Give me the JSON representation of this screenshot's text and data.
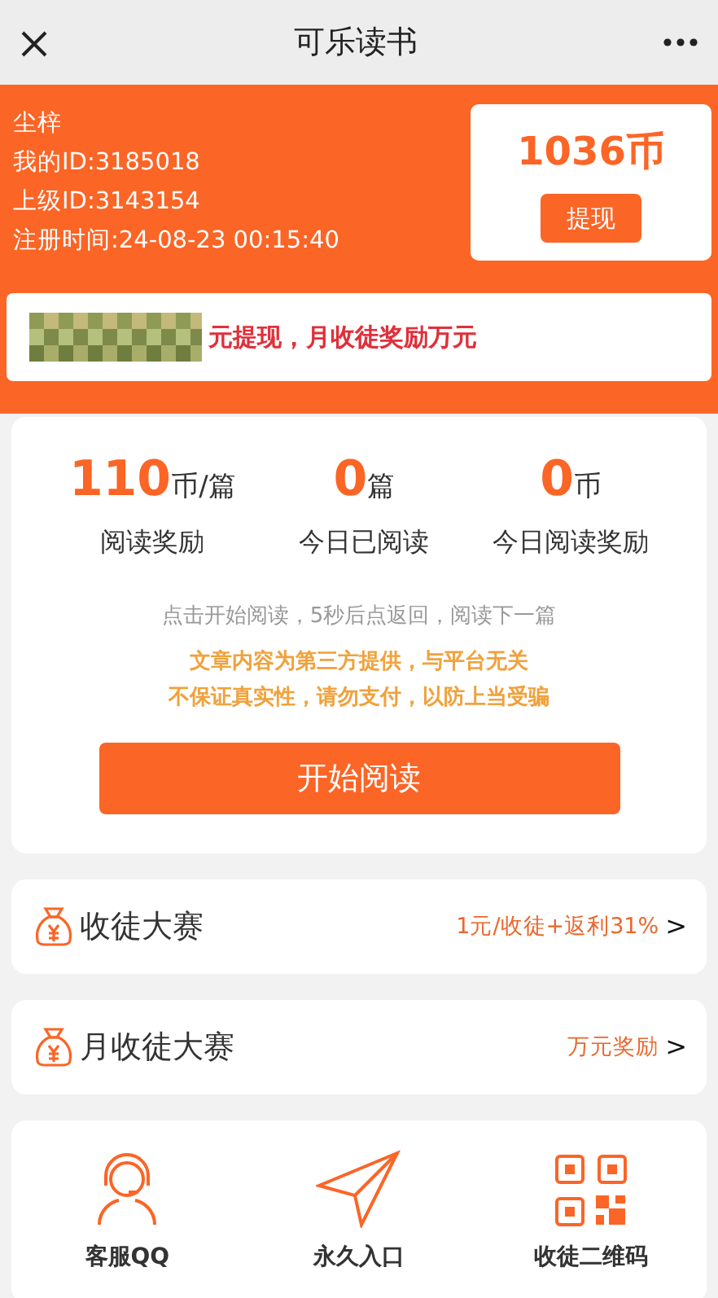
{
  "window": {
    "title": "可乐读书"
  },
  "profile": {
    "lines": [
      "尘梓",
      "我的ID:3185018",
      "上级ID:3143154",
      "注册时间:24-08-23 00:15:40"
    ],
    "coins": "1036币",
    "withdraw": "提现"
  },
  "notice": {
    "text": "元提现，月收徒奖励万元"
  },
  "stats": [
    {
      "value": "110",
      "unit": "币/篇",
      "label": "阅读奖励"
    },
    {
      "value": "0",
      "unit": "篇",
      "label": "今日已阅读"
    },
    {
      "value": "0",
      "unit": "币",
      "label": "今日阅读奖励"
    }
  ],
  "hint": "点击开始阅读，5秒后点返回，阅读下一篇",
  "warnings": [
    "文章内容为第三方提供，与平台无关",
    "不保证真实性，请勿支付，以防上当受骗"
  ],
  "start_button": "开始阅读",
  "contests": [
    {
      "title": "收徒大赛",
      "detail": "1元/收徒+返利31%",
      "arrow": ">"
    },
    {
      "title": "月收徒大赛",
      "detail": "万元奖励",
      "arrow": ">"
    }
  ],
  "shortcuts": [
    {
      "kind": "support",
      "label": "客服QQ"
    },
    {
      "kind": "entry",
      "label": "永久入口"
    },
    {
      "kind": "qrcode",
      "label": "收徒二维码"
    }
  ]
}
